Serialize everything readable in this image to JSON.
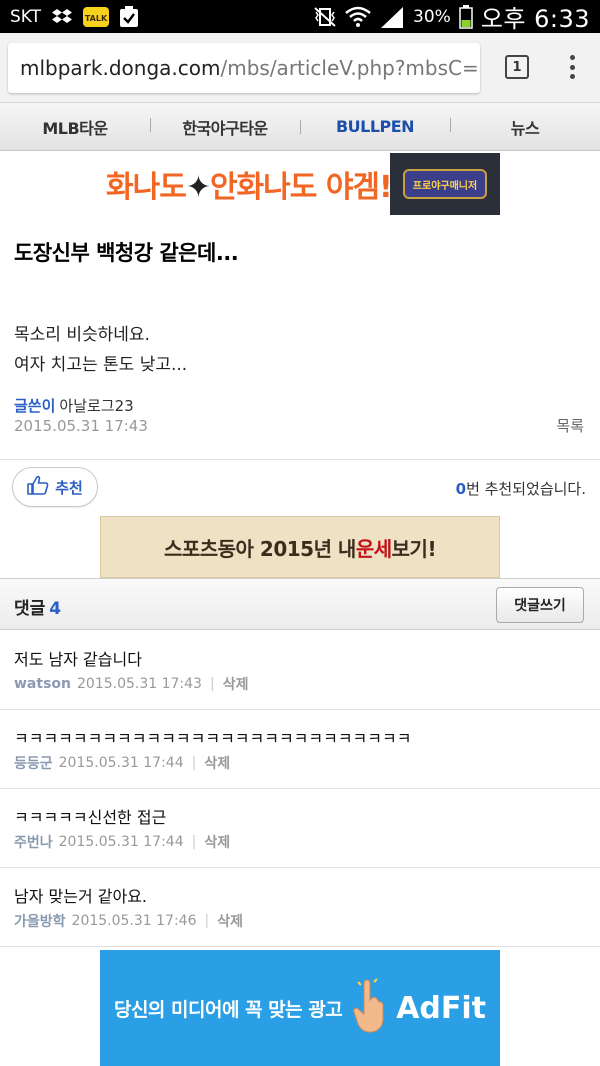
{
  "statusbar": {
    "carrier": "SKT",
    "talk_badge": "TALK",
    "battery": "30%",
    "time": "오후 6:33"
  },
  "browser": {
    "url_domain": "mlbpark.donga.com",
    "url_path": "/mbs/articleV.php?mbsC=",
    "tab_count": "1"
  },
  "nav": {
    "items": [
      "MLB타운",
      "한국야구타운",
      "BULLPEN",
      "뉴스"
    ]
  },
  "banner_top": {
    "text_a": "화나도",
    "text_b": "안화나도",
    "text_c": "야겜!",
    "logo_text": "프로야구매니저"
  },
  "article": {
    "title": "도장신부 백청강 같은데...",
    "body_line1": "목소리 비슷하네요.",
    "body_line2": "여자 치고는 톤도 낮고...",
    "author_label": "글쓴이",
    "author_name": "아날로그23",
    "date": "2015.05.31 17:43",
    "list_label": "목록"
  },
  "recommend": {
    "button_label": "추천",
    "count": "0",
    "count_suffix": "번 추천되었습니다."
  },
  "banner_mid": {
    "text_a": "스포츠동아 2015년 내 ",
    "text_b": "운세",
    "text_c": "보기!"
  },
  "comments_header": {
    "title": "댓글",
    "count": "4",
    "write_label": "댓글쓰기"
  },
  "comments": [
    {
      "text": "저도 남자 같습니다",
      "author": "watson",
      "date": "2015.05.31 17:43",
      "delete": "삭제"
    },
    {
      "text": "ㅋㅋㅋㅋㅋㅋㅋㅋㅋㅋㅋㅋㅋㅋㅋㅋㅋㅋㅋㅋㅋㅋㅋㅋㅋㅋㅋ",
      "author": "등등군",
      "date": "2015.05.31 17:44",
      "delete": "삭제"
    },
    {
      "text": "ㅋㅋㅋㅋㅋ신선한 접근",
      "author": "주번나",
      "date": "2015.05.31 17:44",
      "delete": "삭제"
    },
    {
      "text": "남자 맞는거 같아요.",
      "author": "가을방학",
      "date": "2015.05.31 17:46",
      "delete": "삭제"
    }
  ],
  "banner_bottom": {
    "text": "당신의 미디어에 꼭 맞는 광고",
    "brand": "AdFit"
  }
}
